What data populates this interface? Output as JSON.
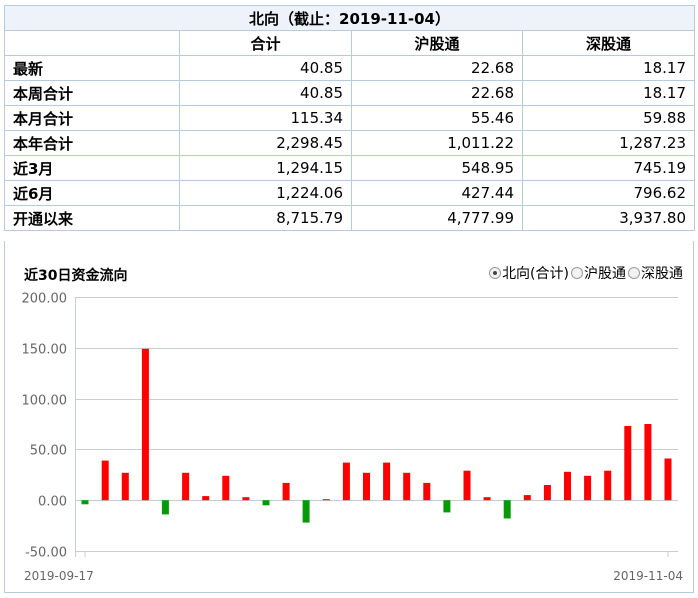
{
  "summary": {
    "title": "北向（截止：2019-11-04）",
    "columns": [
      "合计",
      "沪股通",
      "深股通"
    ],
    "rows": [
      {
        "label": "最新",
        "values": [
          "40.85",
          "22.68",
          "18.17"
        ]
      },
      {
        "label": "本周合计",
        "values": [
          "40.85",
          "22.68",
          "18.17"
        ]
      },
      {
        "label": "本月合计",
        "values": [
          "115.34",
          "55.46",
          "59.88"
        ]
      },
      {
        "label": "本年合计",
        "values": [
          "2,298.45",
          "1,011.22",
          "1,287.23"
        ]
      },
      {
        "label": "近3月",
        "values": [
          "1,294.15",
          "548.95",
          "745.19"
        ]
      },
      {
        "label": "近6月",
        "values": [
          "1,224.06",
          "427.44",
          "796.62"
        ]
      },
      {
        "label": "开通以来",
        "values": [
          "8,715.79",
          "4,777.99",
          "3,937.80"
        ]
      }
    ]
  },
  "chart_section": {
    "title": "近30日资金流向",
    "options": [
      {
        "label": "北向(合计)",
        "checked": true
      },
      {
        "label": "沪股通",
        "checked": false
      },
      {
        "label": "深股通",
        "checked": false
      }
    ]
  },
  "colors": {
    "positive": "#ff0000",
    "negative": "#079a07",
    "grid": "#c8ccd4"
  },
  "chart_data": {
    "type": "bar",
    "title": "近30日资金流向",
    "ylim": [
      -50,
      200
    ],
    "yticks": [
      "200.00",
      "150.00",
      "100.00",
      "50.00",
      "0.00",
      "-50.00"
    ],
    "ytick_values": [
      200,
      150,
      100,
      50,
      0,
      -50
    ],
    "xtick_labels": [
      "2019-09-17",
      "2019-11-04"
    ],
    "values": [
      -4,
      39,
      27,
      149,
      -14,
      27,
      4,
      24,
      3,
      -5,
      17,
      -22,
      1,
      37,
      27,
      37,
      27,
      17,
      -12,
      29,
      3,
      -18,
      5,
      15,
      28,
      24,
      29,
      73,
      75,
      41
    ],
    "grid": true
  }
}
